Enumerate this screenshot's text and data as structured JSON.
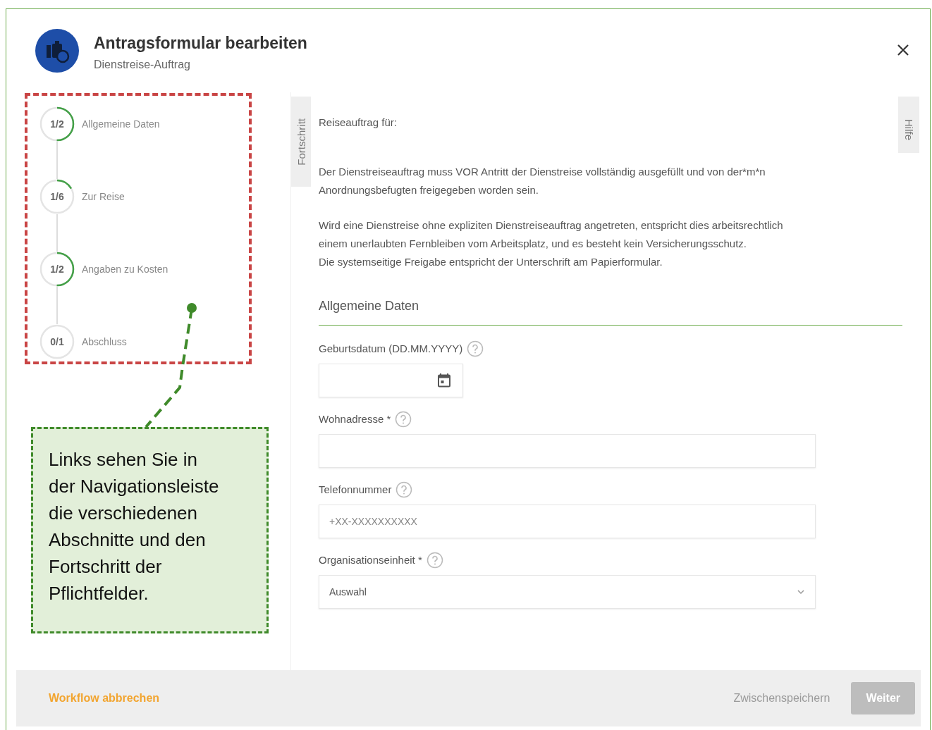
{
  "dialog": {
    "title": "Antragsformular bearbeiten",
    "subtitle": "Dienstreise-Auftrag"
  },
  "steps": [
    {
      "count": "1/2",
      "label": "Allgemeine Daten"
    },
    {
      "count": "1/6",
      "label": "Zur Reise"
    },
    {
      "count": "1/2",
      "label": "Angaben zu Kosten"
    },
    {
      "count": "0/1",
      "label": "Abschluss"
    }
  ],
  "side_tabs": {
    "left": "Fortschritt",
    "right": "Hilfe"
  },
  "intro": {
    "heading": "Reiseauftrag für:",
    "paragraphs": [
      [
        "Der Dienstreiseauftrag muss VOR Antritt der Dienstreise vollständig ausgefüllt und von der*m*n Anordnungsbefugten freigegeben worden sein."
      ],
      [
        "Wird eine Dienstreise ohne expliziten Dienstreiseauftrag angetreten, entspricht dies arbeitsrechtlich einem unerlaubten Fernbleiben vom Arbeitsplatz, und es besteht kein Versicherungsschutz.",
        "Die systemseitige Freigabe entspricht der Unterschrift am Papierformular."
      ]
    ]
  },
  "section": {
    "title": "Allgemeine Daten"
  },
  "fields": [
    {
      "kind": "date",
      "label": "Geburtsdatum (DD.MM.YYYY)"
    },
    {
      "kind": "text",
      "label": "Wohnadresse *"
    },
    {
      "kind": "text",
      "label": "Telefonnummer",
      "placeholder": "+XX-XXXXXXXXXX"
    },
    {
      "kind": "select",
      "label": "Organisationseinheit *",
      "value": "Auswahl"
    }
  ],
  "footer": {
    "cancel": "Workflow abbrechen",
    "buttons": [
      {
        "label": "Zwischenspeichern",
        "kind": "flat",
        "disabled": true
      },
      {
        "label": "Weiter",
        "kind": "raised",
        "disabled": true
      }
    ]
  },
  "annotation": {
    "text": "Links sehen Sie in der Navigationsleiste die verschiedenen Abschnitte und den Fortschritt der Pflichtfelder."
  }
}
